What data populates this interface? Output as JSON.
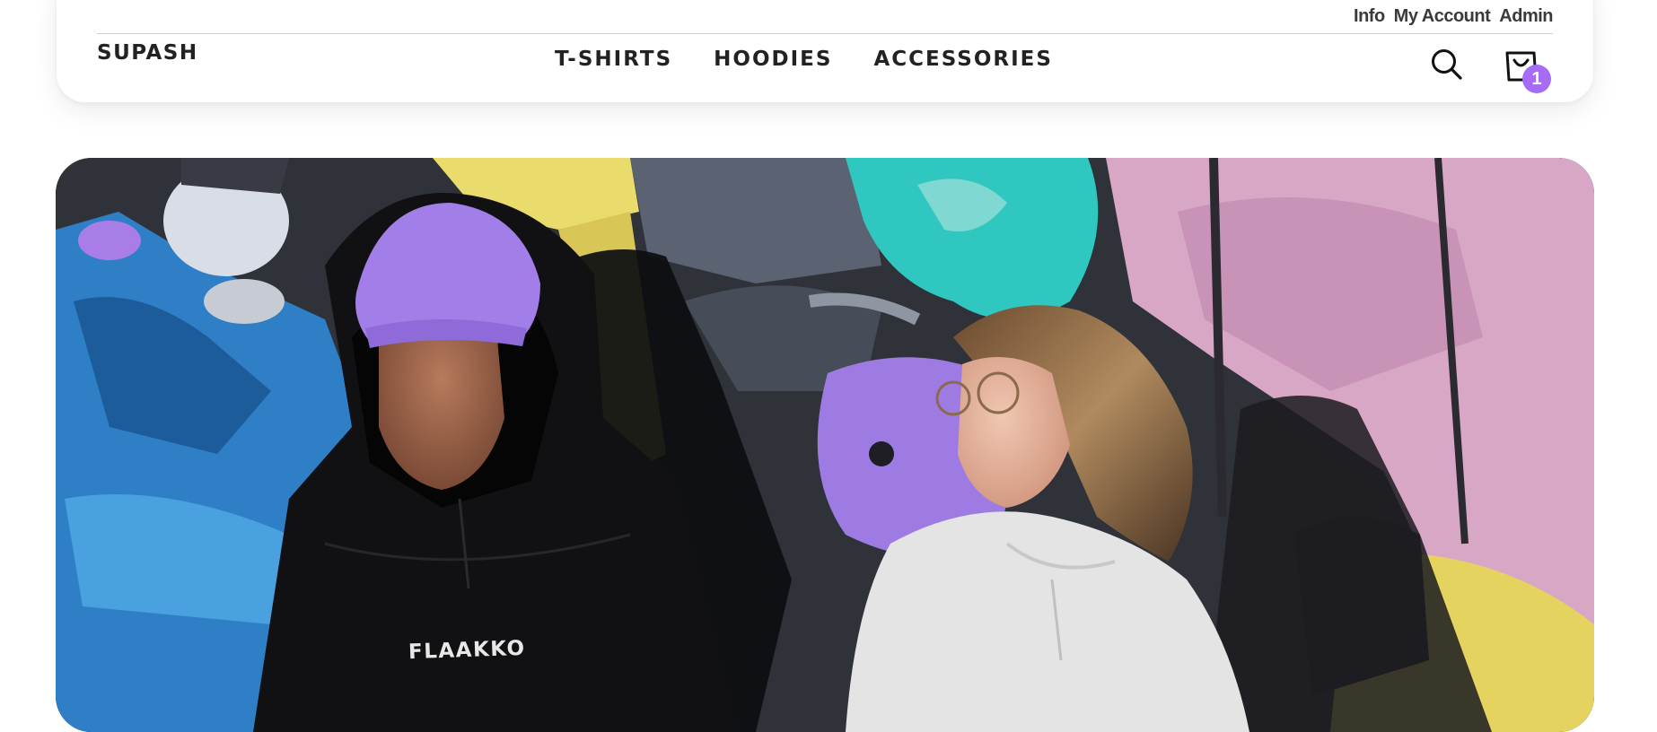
{
  "header": {
    "util_links": [
      "Info",
      "My Account",
      "Admin"
    ],
    "logo": "SUPASH",
    "nav": [
      "T-SHIRTS",
      "HOODIES",
      "ACCESSORIES"
    ],
    "icons": {
      "search": "search-icon",
      "cart": "shopping-bag-icon"
    },
    "cart_count": "1",
    "accent_color": "#a66cf5"
  },
  "hero": {
    "image": "two models in hoodies against graffiti wall",
    "hoodie_print": "FLAAKKO"
  }
}
